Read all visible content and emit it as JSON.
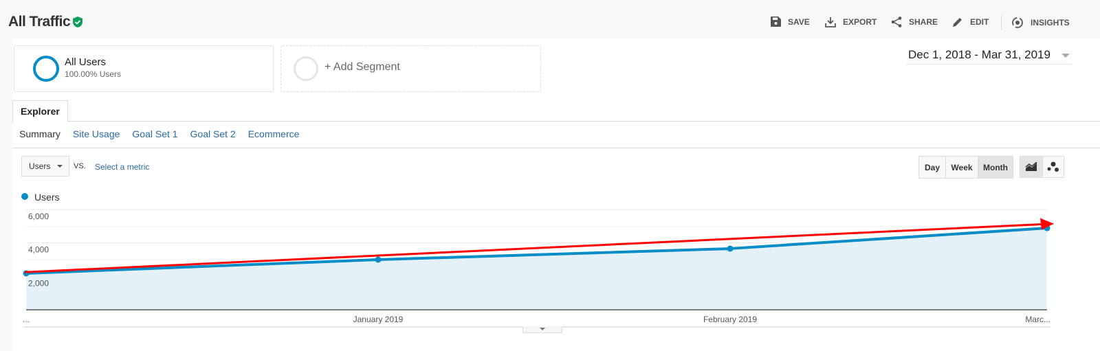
{
  "header": {
    "title": "All Traffic",
    "verified_icon": "shield-check-icon",
    "toolbar": [
      {
        "label": "SAVE",
        "icon": "save-icon"
      },
      {
        "label": "EXPORT",
        "icon": "export-icon"
      },
      {
        "label": "SHARE",
        "icon": "share-icon"
      },
      {
        "label": "EDIT",
        "icon": "edit-icon"
      },
      {
        "label": "INSIGHTS",
        "icon": "insights-icon"
      }
    ]
  },
  "segments": [
    {
      "name": "All Users",
      "detail": "100.00% Users"
    },
    {
      "name": "+ Add Segment"
    }
  ],
  "date_range": "Dec 1, 2018 - Mar 31, 2019",
  "tabs": [
    "Explorer"
  ],
  "subtabs": [
    "Summary",
    "Site Usage",
    "Goal Set 1",
    "Goal Set 2",
    "Ecommerce"
  ],
  "metric": {
    "selected": "Users",
    "vs": "VS.",
    "select_metric": "Select a metric"
  },
  "granularity": {
    "options": [
      "Day",
      "Week",
      "Month"
    ],
    "selected": "Month"
  },
  "chart_types": [
    "line-chart-icon",
    "motion-chart-icon"
  ],
  "colors": {
    "series": "#058dc7",
    "fill": "#e5f1f8",
    "annotation": "#ff0000"
  },
  "chart_data": {
    "type": "area",
    "legend": [
      "Users"
    ],
    "x": [
      "...",
      "January 2019",
      "February 2019",
      "Marc..."
    ],
    "series": [
      {
        "name": "Users",
        "values": [
          2180,
          3000,
          3660,
          4890
        ]
      }
    ],
    "yticks": [
      "6,000",
      "4,000",
      "2,000"
    ],
    "ylim": [
      0,
      6000
    ],
    "grid": true,
    "annotation": {
      "type": "trend-arrow",
      "from": 2250,
      "to": 5150
    }
  }
}
